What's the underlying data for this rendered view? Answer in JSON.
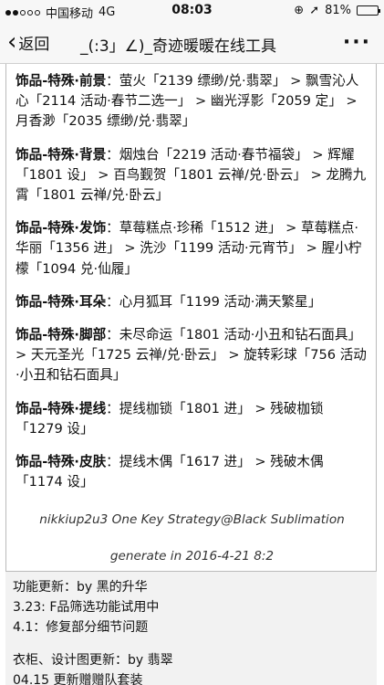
{
  "status": {
    "carrier": "中国移动",
    "network": "4G",
    "time": "08:03",
    "battery": "81%",
    "battery_level": 0.81
  },
  "nav": {
    "back_label": "返回",
    "title": "_(:3」∠)_奇迹暖暖在线工具",
    "more": "···"
  },
  "entries": [
    {
      "category": "饰品-特殊·前景",
      "text": "：萤火「2139 缥缈/兑·翡翠」 > 飘雪沁人心「2114 活动·春节二选一」 > 幽光浮影「2059 定」 > 月香渺「2035 缥缈/兑·翡翠」"
    },
    {
      "category": "饰品-特殊·背景",
      "text": "：烟烛台「2219 活动·春节福袋」 > 辉耀「1801 设」 > 百鸟觐贺「1801 云禅/兑·卧云」 > 龙腾九霄「1801 云禅/兑·卧云」"
    },
    {
      "category": "饰品-特殊·发饰",
      "text": "：草莓糕点·珍稀「1512 进」 > 草莓糕点·华丽「1356 进」 > 洗沙「1199 活动·元宵节」 > 腥小柠檬「1094 兑·仙履」"
    },
    {
      "category": "饰品-特殊·耳朵",
      "text": "：心月狐耳「1199 活动·满天繁星」"
    },
    {
      "category": "饰品-特殊·脚部",
      "text": "：未尽命运「1801 活动·小丑和钻石面具」 > 天元圣光「1725 云禅/兑·卧云」 > 旋转彩球「756 活动·小丑和钻石面具」"
    },
    {
      "category": "饰品-特殊·提线",
      "text": "：提线枷锁「1801 进」 > 残破枷锁「1279 设」"
    },
    {
      "category": "饰品-特殊·皮肤",
      "text": "：提线木偶「1617 进」 > 残破木偶「1174 设」"
    }
  ],
  "footer": {
    "credit": "nikkiup2u3 One Key Strategy@Black Sublimation",
    "generated": "generate in 2016-4-21 8:2"
  },
  "updates": {
    "block1": [
      "功能更新：by 黑的升华",
      "3.23: F品筛选功能试用中",
      "4.1：修复部分细节问题"
    ],
    "block2": [
      "衣柜、设计图更新：by 翡翠",
      "04.15 更新赠赠队套装"
    ]
  }
}
